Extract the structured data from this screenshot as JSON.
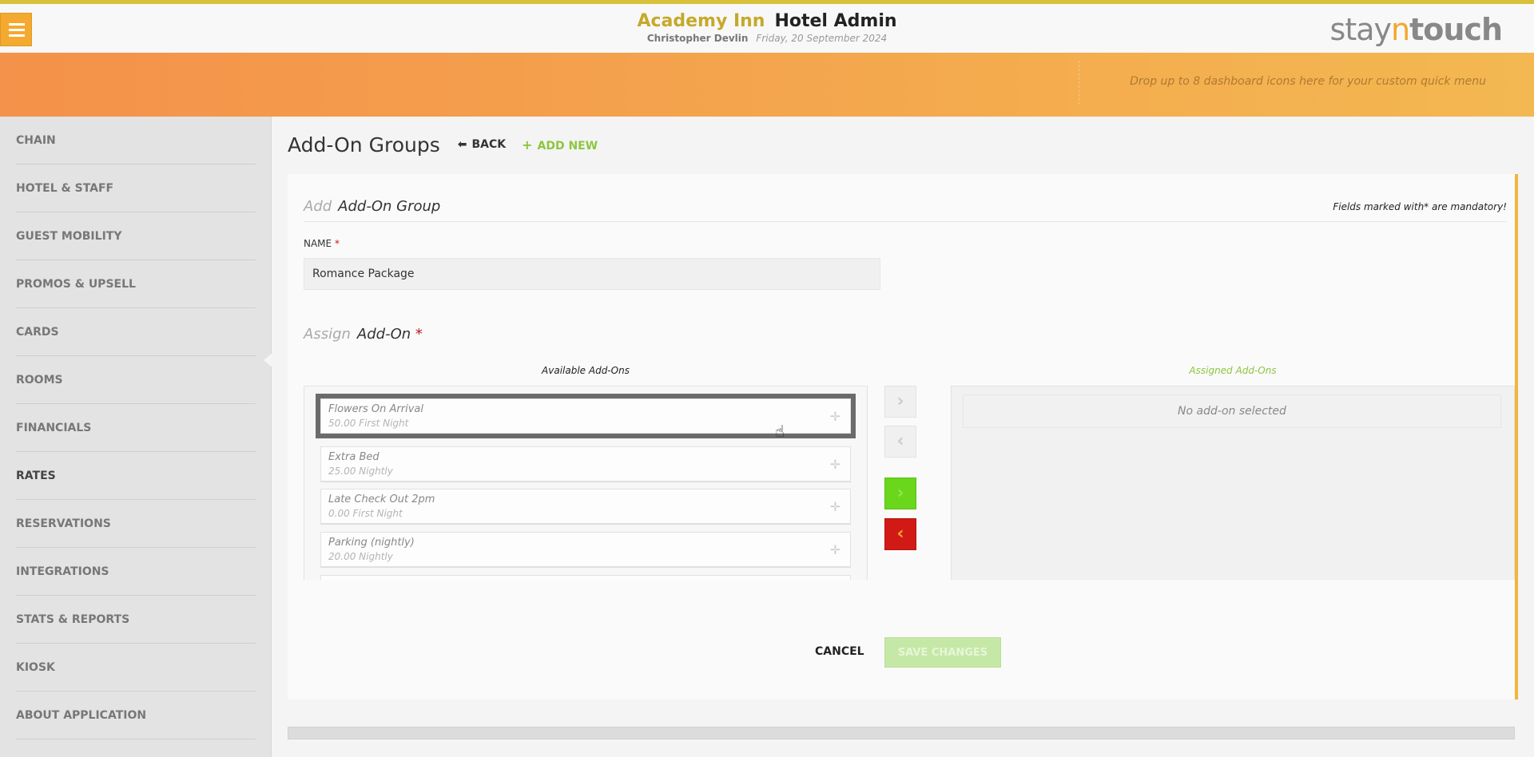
{
  "header": {
    "hotel_name": "Academy Inn",
    "app_name": "Hotel Admin",
    "user_name": "Christopher Devlin",
    "date": "Friday, 20 September 2024",
    "logo_prefix": "stay",
    "logo_mid": "n",
    "logo_suffix": "touch"
  },
  "quick_menu_hint": "Drop up to 8 dashboard icons here for your custom quick menu",
  "sidebar": {
    "items": [
      {
        "label": "CHAIN"
      },
      {
        "label": "HOTEL & STAFF"
      },
      {
        "label": "GUEST MOBILITY"
      },
      {
        "label": "PROMOS & UPSELL"
      },
      {
        "label": "CARDS"
      },
      {
        "label": "ROOMS"
      },
      {
        "label": "FINANCIALS"
      },
      {
        "label": "RATES"
      },
      {
        "label": "RESERVATIONS"
      },
      {
        "label": "INTEGRATIONS"
      },
      {
        "label": "STATS & REPORTS"
      },
      {
        "label": "KIOSK"
      },
      {
        "label": "ABOUT APPLICATION"
      }
    ],
    "active": "RATES"
  },
  "page": {
    "title": "Add-On Groups",
    "back_label": "BACK",
    "add_new_label": "ADD NEW"
  },
  "form": {
    "title_light": "Add",
    "title_dark": "Add-On Group",
    "mandatory_note": "Fields marked with* are mandatory!",
    "name_label": "NAME",
    "required_mark": "*",
    "name_value": "Romance Package",
    "assign_light": "Assign",
    "assign_dark": "Add-On",
    "available_label": "Available Add-Ons",
    "assigned_label": "Assigned Add-Ons",
    "available_addons": [
      {
        "name": "Flowers On Arrival",
        "price": "50.00 First Night"
      },
      {
        "name": "Extra Bed",
        "price": "25.00 Nightly"
      },
      {
        "name": "Late Check Out 2pm",
        "price": "0.00 First Night"
      },
      {
        "name": "Parking (nightly)",
        "price": "20.00 Nightly"
      }
    ],
    "assigned_empty": "No add-on selected",
    "cancel_label": "CANCEL",
    "save_label": "SAVE CHANGES"
  },
  "colors": {
    "accent_orange": "#f4a930",
    "accent_green": "#8cc63f",
    "move_right_active": "#6ad61c",
    "move_left_active": "#d11a16"
  }
}
